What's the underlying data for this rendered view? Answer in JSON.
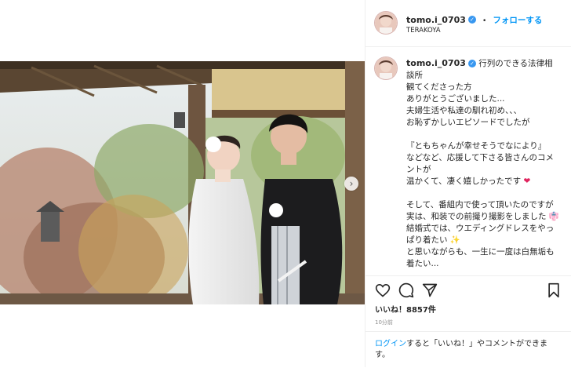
{
  "post": {
    "username": "tomo.i_0703",
    "follow_separator": "•",
    "follow_label": "フォローする",
    "location": "TERAKOYA"
  },
  "caption": {
    "lines": [
      "行列のできる法律相談所",
      "観てくださった方",
      "ありがとうございました...",
      "夫婦生活や私達の馴れ初め、、、",
      "お恥ずかしいエピソードでしたが",
      "",
      "『ともちゃんが幸せそうでなにより』",
      "などなど、応援して下さる皆さんのコメントが",
      "温かくて、凄く嬉しかったです",
      "",
      "そして、番組内で使って頂いたのですが",
      "実は、和装での前撮り撮影をしました",
      "結婚式では、ウエディングドレスをやっぱり着たい",
      "と思いながらも、一生に一度は白無垢も着たい..."
    ]
  },
  "stats": {
    "likes": "いいね！8857件",
    "time": "10分前"
  },
  "login": {
    "link": "ログイン",
    "rest": "すると「いいね！」やコメントができます。"
  },
  "icons": {
    "like": "heart-icon",
    "comment": "comment-icon",
    "share": "share-icon",
    "save": "bookmark-icon",
    "next": "chevron-right-icon",
    "verified": "verified-badge-icon"
  },
  "colors": {
    "link": "#0095f6",
    "verified": "#3897f0",
    "text": "#262626",
    "muted": "#8e8e8e"
  }
}
